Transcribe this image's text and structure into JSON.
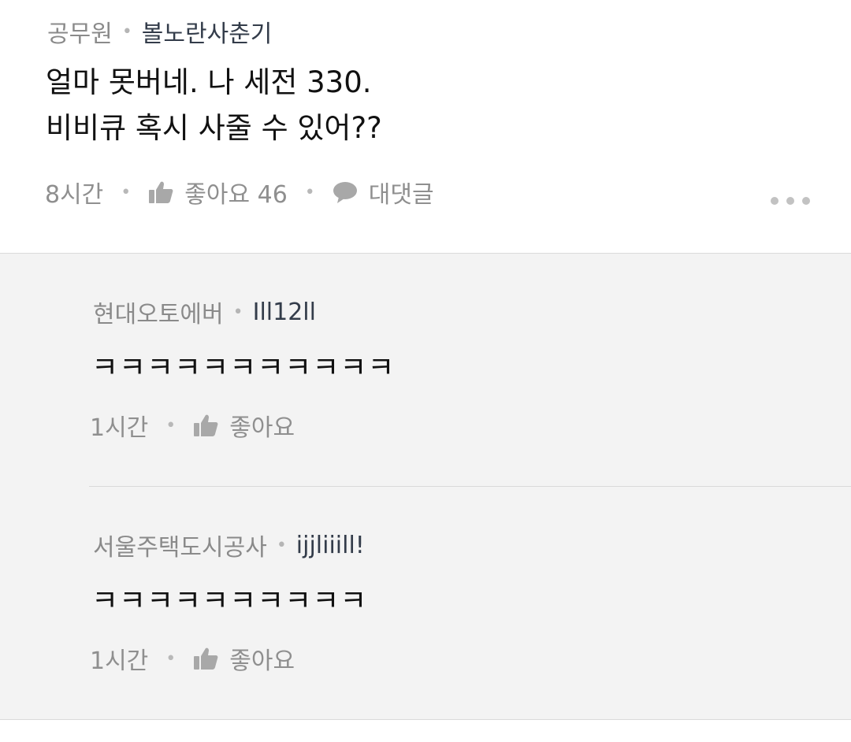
{
  "comment": {
    "company": "공무원",
    "nickname": "볼노란사춘기",
    "lines": [
      "얼마 못버네. 나 세전 330.",
      "비비큐 혹시 사줄 수 있어??"
    ],
    "time": "8시간",
    "like_label": "좋아요 46",
    "reply_label": "대댓글"
  },
  "replies": [
    {
      "company": "현대오토에버",
      "nickname": "Ill12ll",
      "text": "ㅋㅋㅋㅋㅋㅋㅋㅋㅋㅋㅋ",
      "time": "1시간",
      "like_label": "좋아요"
    },
    {
      "company": "서울주택도시공사",
      "nickname": "ijjliiill!",
      "text": "ㅋㅋㅋㅋㅋㅋㅋㅋㅋㅋ",
      "time": "1시간",
      "like_label": "좋아요"
    }
  ],
  "icons": {
    "like": "thumbs-up-icon",
    "reply": "speech-bubble-icon",
    "more": "more-options-icon"
  },
  "colors": {
    "meta_gray": "#8a8a8a",
    "nickname": "#333c4a",
    "reply_bg": "#f3f3f3",
    "icon_gray": "#a8a8a8"
  }
}
